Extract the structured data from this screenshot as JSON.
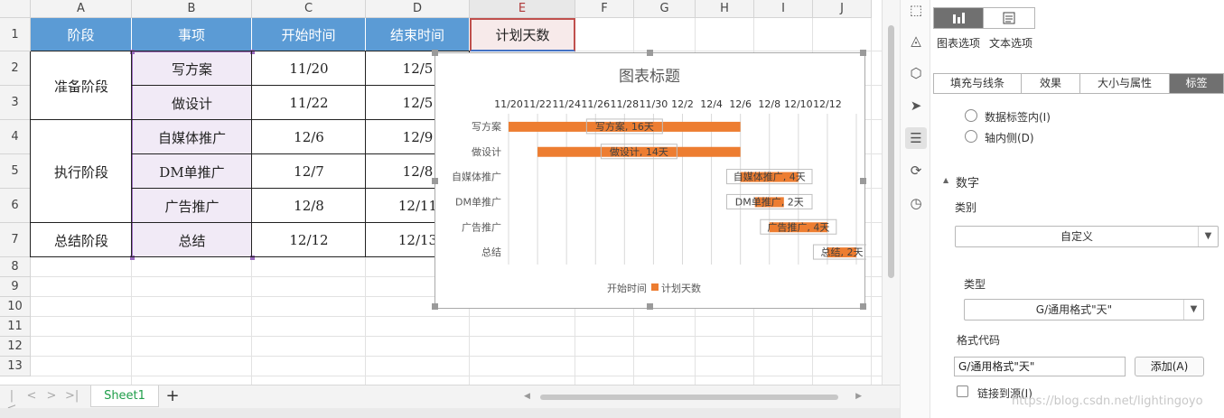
{
  "sheet": {
    "columns": [
      "A",
      "B",
      "C",
      "D",
      "E",
      "F",
      "G",
      "H",
      "I",
      "J"
    ],
    "rows": [
      "1",
      "2",
      "3",
      "4",
      "5",
      "6",
      "7",
      "8",
      "9",
      "10",
      "11",
      "12",
      "13"
    ],
    "header": {
      "phase": "阶段",
      "task": "事项",
      "start": "开始时间",
      "end": "结束时间",
      "days": "计划天数"
    },
    "groups": [
      "准备阶段",
      "执行阶段",
      "总结阶段"
    ],
    "tasks": [
      "写方案",
      "做设计",
      "自媒体推广",
      "DM单推广",
      "广告推广",
      "总结"
    ],
    "starts": [
      "11/20",
      "11/22",
      "12/6",
      "12/7",
      "12/8",
      "12/12"
    ],
    "ends": [
      "12/5",
      "12/5",
      "12/9",
      "12/8",
      "12/11",
      "12/13"
    ]
  },
  "chart_data": {
    "type": "bar",
    "orientation": "horizontal",
    "stacked": true,
    "title": "图表标题",
    "categories": [
      "写方案",
      "做设计",
      "自媒体推广",
      "DM单推广",
      "广告推广",
      "总结"
    ],
    "x_tick_labels": [
      "11/20",
      "11/22",
      "11/24",
      "11/26",
      "11/28",
      "11/30",
      "12/2",
      "12/4",
      "12/6",
      "12/8",
      "12/10",
      "12/12"
    ],
    "x_axis_position": "top",
    "xlim": [
      "11/20",
      "12/14"
    ],
    "series": [
      {
        "name": "开始时间",
        "values": [
          "11/20",
          "11/22",
          "12/6",
          "12/7",
          "12/8",
          "12/12"
        ],
        "visible": false
      },
      {
        "name": "计划天数",
        "values": [
          16,
          14,
          4,
          2,
          4,
          2
        ],
        "color": "#ed7d31"
      }
    ],
    "data_labels": [
      "写方案, 16天",
      "做设计, 14天",
      "自媒体推广, 4天",
      "DM单推广, 2天",
      "广告推广, 4天",
      "总结, 2天"
    ],
    "legend": "bottom",
    "grid": true
  },
  "tabs": {
    "sheet_name": "Sheet1",
    "add": "+"
  },
  "panel": {
    "top_tabs": [
      "图表选项",
      "文本选项"
    ],
    "sub_tabs": [
      "填充与线条",
      "效果",
      "大小与属性",
      "标签"
    ],
    "label_positions": [
      "数据标签内(I)",
      "轴内侧(D)"
    ],
    "number_section": "数字",
    "category_label": "类别",
    "category_value": "自定义",
    "type_label": "类型",
    "type_value": "G/通用格式\"天\"",
    "format_code_label": "格式代码",
    "format_code_value": "G/通用格式\"天\"",
    "add_button": "添加(A)",
    "link_source": "链接到源(I)"
  },
  "side_icons": [
    "shapes-icon",
    "fill-icon",
    "effect-icon",
    "cursor-icon",
    "properties-icon",
    "crop-icon",
    "history-icon"
  ],
  "watermark": "https://blog.csdn.net/lightingoyo",
  "colors": {
    "header_blue": "#5b9bd5",
    "task_purple": "#f1eaf6",
    "bar_orange": "#ed7d31",
    "panel_gray": "#707070"
  }
}
